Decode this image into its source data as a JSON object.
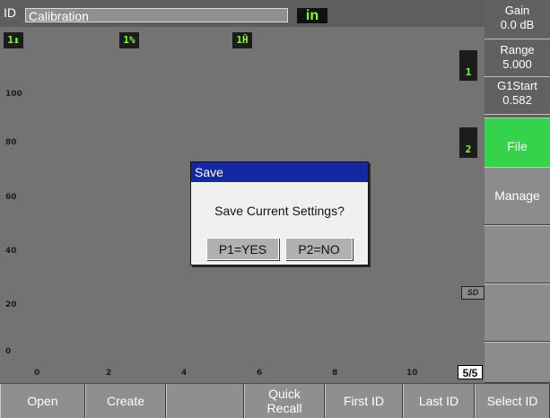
{
  "status": {
    "id_label": "ID",
    "id_value": "Calibration",
    "unit": "in"
  },
  "plot": {
    "icons": {
      "gate1": "1↨",
      "percent": "1%",
      "thickness": "1Ĥ",
      "gate_flag_1": "1",
      "gate_flag_2": "2"
    },
    "y_ticks": [
      "100",
      "80",
      "60",
      "40",
      "20",
      "0"
    ],
    "x_ticks": [
      "0",
      "2",
      "4",
      "6",
      "8",
      "10"
    ],
    "sd_label": "SD",
    "page_indicator": "5/5"
  },
  "params": {
    "gain_label": "Gain",
    "gain_value": "0.0 dB",
    "range_label": "Range",
    "range_value": "5.000",
    "g1start_label": "G1Start",
    "g1start_value": "0.582"
  },
  "menu": {
    "items": [
      "File",
      "Manage",
      "",
      "",
      "",
      ""
    ]
  },
  "fkeys": [
    "Open",
    "Create",
    "",
    "Quick\nRecall",
    "First ID",
    "Last ID",
    "Select ID"
  ],
  "dialog": {
    "title": "Save",
    "message": "Save Current Settings?",
    "yes": "P1=YES",
    "no": "P2=NO"
  },
  "colors": {
    "accent_green": "#35d24c",
    "dialog_title": "#1628a1",
    "icon_green": "#7dfc3c"
  }
}
